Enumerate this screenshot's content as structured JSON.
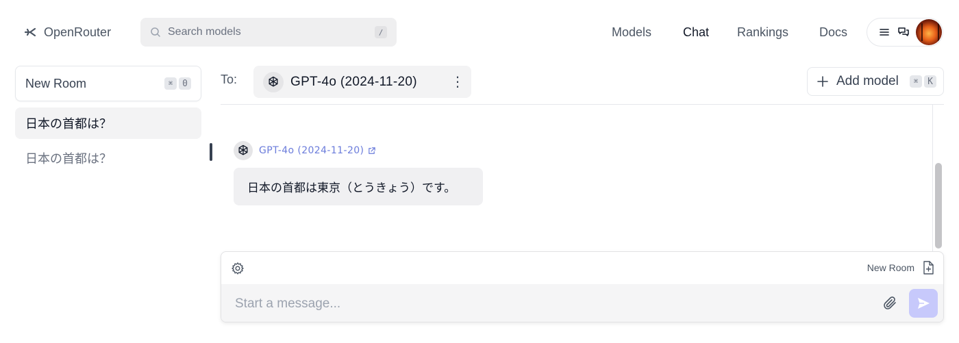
{
  "header": {
    "logo_text": "OpenRouter",
    "search_placeholder": "Search models",
    "search_shortcut": "/",
    "nav": [
      {
        "label": "Models",
        "active": false
      },
      {
        "label": "Chat",
        "active": true
      },
      {
        "label": "Rankings",
        "active": false
      },
      {
        "label": "Docs",
        "active": false
      }
    ]
  },
  "sidebar": {
    "new_room_label": "New Room",
    "new_room_shortcut": [
      "⌘",
      "0"
    ],
    "rooms": [
      {
        "title": "日本の首都は？",
        "active": true
      },
      {
        "title": "日本の首都は？",
        "active": false
      }
    ]
  },
  "toolbar": {
    "to_label": "To:",
    "selected_model": "GPT-4o (2024-11-20)",
    "add_model_label": "Add model",
    "add_model_shortcut": [
      "⌘",
      "K"
    ]
  },
  "messages": [
    {
      "model": "GPT-4o (2024-11-20)",
      "text": "日本の首都は東京（とうきょう）です。"
    }
  ],
  "composer": {
    "room_label": "New Room",
    "placeholder": "Start a message..."
  },
  "colors": {
    "accent_link": "#6b7cdb",
    "send_button": "#c7c9fb",
    "active_room_bg": "#f3f3f4"
  }
}
